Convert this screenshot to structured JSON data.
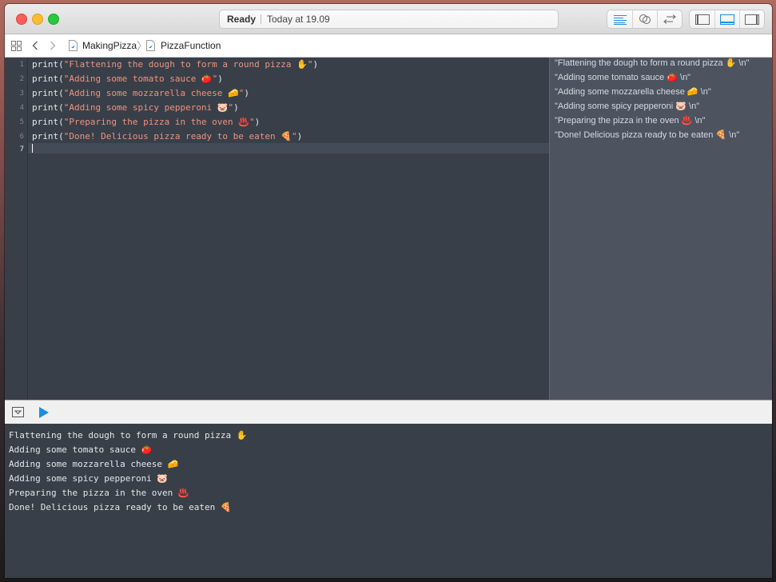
{
  "titlebar": {
    "status": "Ready",
    "timestamp": "Today at 19.09",
    "editor_mode_buttons": [
      {
        "icon": "standard-editor-icon",
        "active": true
      },
      {
        "icon": "assistant-editor-icon",
        "active": false
      },
      {
        "icon": "version-editor-icon",
        "active": false
      }
    ],
    "view_buttons": [
      {
        "icon": "navigator-panel-icon",
        "active": false
      },
      {
        "icon": "debug-area-icon",
        "active": true
      },
      {
        "icon": "utilities-panel-icon",
        "active": false
      }
    ],
    "accent_color": "#1a8fe3"
  },
  "navbar": {
    "breadcrumb": [
      "MakingPizza",
      "PizzaFunction"
    ]
  },
  "editor": {
    "line_numbers": [
      "1",
      "2",
      "3",
      "4",
      "5",
      "6",
      "7"
    ],
    "current_line": "7",
    "lines": [
      {
        "fn": "print",
        "open": "(",
        "str": "\"Flattening the dough to form a round pizza ✋\"",
        "close": ")"
      },
      {
        "fn": "print",
        "open": "(",
        "str": "\"Adding some tomato sauce 🍅\"",
        "close": ")"
      },
      {
        "fn": "print",
        "open": "(",
        "str": "\"Adding some mozzarella cheese 🧀\"",
        "close": ")"
      },
      {
        "fn": "print",
        "open": "(",
        "str": "\"Adding some spicy pepperoni 🐷\"",
        "close": ")"
      },
      {
        "fn": "print",
        "open": "(",
        "str": "\"Preparing the pizza in the oven ♨️\"",
        "close": ")"
      },
      {
        "fn": "print",
        "open": "(",
        "str": "\"Done! Delicious pizza ready to be eaten 🍕\"",
        "close": ")"
      }
    ]
  },
  "results": [
    "\"Flattening the dough to form a round pizza ✋ \\n\"",
    "\"Adding some tomato sauce 🍅 \\n\"",
    "\"Adding some mozzarella cheese 🧀 \\n\"",
    "\"Adding some spicy pepperoni 🐷 \\n\"",
    "\"Preparing the pizza in the oven ♨️ \\n\"",
    "\"Done! Delicious pizza ready to be eaten 🍕 \\n\""
  ],
  "console": [
    "Flattening the dough to form a round pizza ✋",
    "Adding some tomato sauce 🍅",
    "Adding some mozzarella cheese 🧀",
    "Adding some spicy pepperoni 🐷",
    "Preparing the pizza in the oven ♨️",
    "Done! Delicious pizza ready to be eaten 🍕"
  ]
}
